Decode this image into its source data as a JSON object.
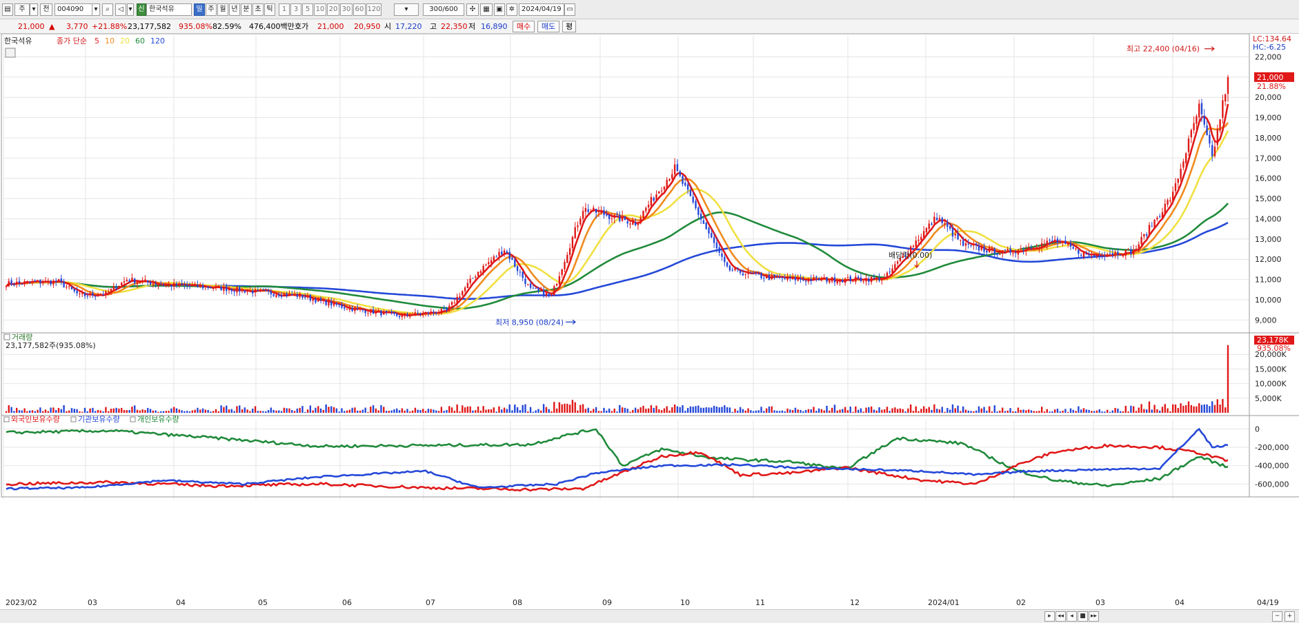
{
  "toolbar": {
    "period_label": "주",
    "market_label": "전",
    "code": "004090",
    "badge": "신",
    "name": "한국석유",
    "timeframes": [
      "일",
      "주",
      "월",
      "년",
      "분",
      "초",
      "틱"
    ],
    "intervals": [
      "1",
      "3",
      "5",
      "10",
      "20",
      "30",
      "60",
      "120"
    ],
    "count": "300",
    "count_total": "/600",
    "date": "2024/04/19"
  },
  "quote": {
    "price": "21,000",
    "change": "3,770",
    "change_pct": "+21.88%",
    "volume": "23,177,582",
    "vol_ratio": "935.08%",
    "turnover": "82.59%",
    "amount": "476,400백만",
    "ask_label": "호가",
    "ask": "21,000",
    "bid": "20,950",
    "open_label": "시",
    "open": "17,220",
    "high_label": "고",
    "high": "22,350",
    "low_label": "저",
    "low": "16,890",
    "buy_label": "매수",
    "sell_label": "매도",
    "eval_label": "평"
  },
  "chart_data": {
    "type": "candlestick",
    "stock_label": "한국석유",
    "ma_label": "종가 단순",
    "ma_periods": [
      "5",
      "10",
      "20",
      "60",
      "120"
    ],
    "ma_colors": [
      "#e01818",
      "#f08a1c",
      "#f0e040",
      "#1f8a3a",
      "#2448d8"
    ],
    "price_axis": [
      "22,000",
      "21,000",
      "20,000",
      "19,000",
      "18,000",
      "17,000",
      "16,000",
      "15,000",
      "14,000",
      "13,000",
      "12,000",
      "11,000",
      "10,000",
      "9,000"
    ],
    "price_axis_values": [
      22000,
      21000,
      20000,
      19000,
      18000,
      17000,
      16000,
      15000,
      14000,
      13000,
      12000,
      11000,
      10000,
      9000
    ],
    "ylim": [
      8500,
      22800
    ],
    "lc_label": "LC:134.64",
    "hc_label": "HC:-6.25",
    "last_price_tag": "21,000",
    "last_pct_tag": "21.88%",
    "high_note": "최고 22,400 (04/16)",
    "low_note": "최저 8,950 (08/24)",
    "dividend_note": "배당락(0.00)",
    "months": [
      "2023/02",
      "03",
      "04",
      "05",
      "06",
      "07",
      "08",
      "09",
      "10",
      "11",
      "12",
      "2024/01",
      "02",
      "03",
      "04",
      "04/19"
    ],
    "price_keypoints": [
      [
        0,
        10800
      ],
      [
        8,
        10850
      ],
      [
        20,
        10900
      ],
      [
        28,
        10200
      ],
      [
        38,
        10300
      ],
      [
        46,
        11000
      ],
      [
        60,
        10750
      ],
      [
        80,
        10600
      ],
      [
        95,
        10400
      ],
      [
        112,
        10200
      ],
      [
        130,
        9600
      ],
      [
        150,
        9200
      ],
      [
        168,
        9450
      ],
      [
        180,
        11400
      ],
      [
        190,
        12500
      ],
      [
        200,
        10500
      ],
      [
        208,
        10200
      ],
      [
        220,
        14500
      ],
      [
        240,
        13800
      ],
      [
        255,
        16500
      ],
      [
        265,
        14000
      ],
      [
        275,
        11500
      ],
      [
        290,
        11100
      ],
      [
        305,
        11000
      ],
      [
        320,
        11000
      ],
      [
        335,
        11050
      ],
      [
        345,
        12600
      ],
      [
        355,
        14100
      ],
      [
        365,
        12700
      ],
      [
        380,
        12300
      ],
      [
        400,
        12900
      ],
      [
        412,
        12200
      ],
      [
        430,
        12400
      ],
      [
        445,
        15200
      ],
      [
        455,
        19500
      ],
      [
        460,
        17000
      ],
      [
        466,
        21000
      ]
    ],
    "volume_label": "거래량",
    "volume_value": "23,177,582주(935.08%)",
    "volume_axis": [
      "20,000K",
      "15,000K",
      "10,000K",
      "5,000K"
    ],
    "volume_axis_values": [
      20000,
      15000,
      10000,
      5000
    ],
    "volume_max": 25000,
    "volume_tag": "23,178K",
    "volume_pct_tag": "935.08%",
    "holding_labels": [
      "외국인보유수량",
      "기관보유수량",
      "개인보유수량"
    ],
    "holding_colors": [
      "#e01818",
      "#2448d8",
      "#1f8a3a"
    ],
    "holding_axis": [
      "0",
      "-200,000",
      "-400,000",
      "-600,000"
    ],
    "holding_axis_values": [
      0,
      -200000,
      -400000,
      -600000
    ],
    "holding_ylim": [
      -740000,
      40000
    ],
    "foreign_keypoints": [
      [
        0,
        -600000
      ],
      [
        40,
        -580000
      ],
      [
        80,
        -620000
      ],
      [
        120,
        -600000
      ],
      [
        160,
        -640000
      ],
      [
        200,
        -660000
      ],
      [
        220,
        -650000
      ],
      [
        250,
        -300000
      ],
      [
        265,
        -250000
      ],
      [
        280,
        -500000
      ],
      [
        300,
        -480000
      ],
      [
        320,
        -420000
      ],
      [
        350,
        -560000
      ],
      [
        370,
        -600000
      ],
      [
        385,
        -400000
      ],
      [
        400,
        -250000
      ],
      [
        420,
        -180000
      ],
      [
        440,
        -200000
      ],
      [
        455,
        -260000
      ],
      [
        466,
        -350000
      ]
    ],
    "institution_keypoints": [
      [
        0,
        -650000
      ],
      [
        30,
        -640000
      ],
      [
        60,
        -560000
      ],
      [
        90,
        -600000
      ],
      [
        120,
        -520000
      ],
      [
        160,
        -460000
      ],
      [
        180,
        -640000
      ],
      [
        210,
        -600000
      ],
      [
        225,
        -480000
      ],
      [
        250,
        -400000
      ],
      [
        280,
        -390000
      ],
      [
        300,
        -420000
      ],
      [
        350,
        -460000
      ],
      [
        370,
        -500000
      ],
      [
        390,
        -460000
      ],
      [
        420,
        -440000
      ],
      [
        440,
        -430000
      ],
      [
        455,
        0
      ],
      [
        460,
        -200000
      ],
      [
        466,
        -180000
      ]
    ],
    "individual_keypoints": [
      [
        0,
        -40000
      ],
      [
        40,
        -20000
      ],
      [
        80,
        -100000
      ],
      [
        120,
        -190000
      ],
      [
        160,
        -180000
      ],
      [
        200,
        -170000
      ],
      [
        215,
        -60000
      ],
      [
        225,
        0
      ],
      [
        235,
        -400000
      ],
      [
        250,
        -220000
      ],
      [
        270,
        -320000
      ],
      [
        300,
        -360000
      ],
      [
        320,
        -440000
      ],
      [
        340,
        -100000
      ],
      [
        365,
        -160000
      ],
      [
        385,
        -450000
      ],
      [
        400,
        -560000
      ],
      [
        420,
        -620000
      ],
      [
        440,
        -540000
      ],
      [
        455,
        -300000
      ],
      [
        466,
        -420000
      ]
    ]
  },
  "statusbar": {
    "buttons": [
      "▸",
      "◂◂",
      "◂",
      "■",
      "▸▸",
      "−",
      "+"
    ]
  }
}
